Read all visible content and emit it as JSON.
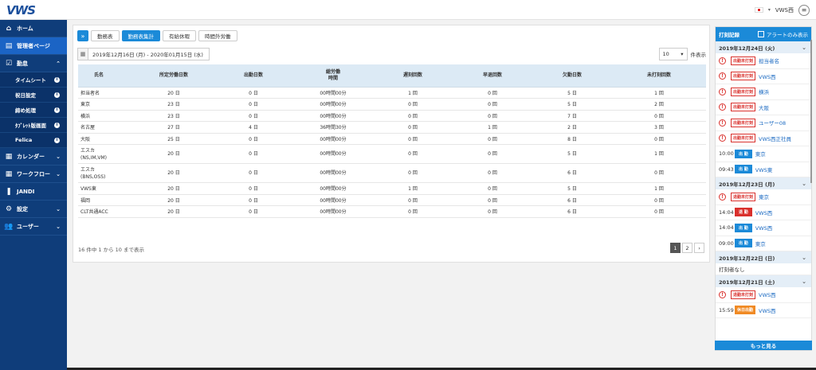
{
  "app": {
    "logo": "VWS",
    "user": "VWS西"
  },
  "sidebar": {
    "items": [
      {
        "label": "ホーム",
        "icon": "home-icon",
        "glyph": "⌂"
      },
      {
        "label": "管理者ページ",
        "icon": "admin-icon",
        "glyph": "▤"
      },
      {
        "label": "勤怠",
        "icon": "attendance-icon",
        "glyph": "☑"
      }
    ],
    "subs": [
      "タイムシート",
      "祝日設定",
      "締め処理",
      "ﾀﾌﾞﾚｯﾄ版画面",
      "Felica"
    ],
    "lower": [
      {
        "label": "カレンダー",
        "glyph": "▦"
      },
      {
        "label": "ワークフロー",
        "glyph": "▦"
      },
      {
        "label": "JANDI",
        "glyph": "❚"
      },
      {
        "label": "設定",
        "glyph": "⚙"
      },
      {
        "label": "ユーザー",
        "glyph": "👥"
      }
    ]
  },
  "tabs": [
    "勤務表",
    "勤務表集計",
    "有給休暇",
    "時間外労働"
  ],
  "date_range": "2019年12月16日 (月) - 2020年01月15日 (水)",
  "per_page": {
    "value": "10",
    "label": "件表示"
  },
  "table": {
    "headers": [
      "氏名",
      "所定労働日数",
      "出勤日数",
      "総労働\n時間",
      "遅刻回数",
      "早退回数",
      "欠勤日数",
      "未打刻回数"
    ],
    "rows": [
      [
        "担当者名",
        "20 日",
        "0 日",
        "00時間00分",
        "1 回",
        "0 回",
        "5 日",
        "1 回"
      ],
      [
        "東京",
        "23 日",
        "0 日",
        "00時間00分",
        "0 回",
        "0 回",
        "5 日",
        "2 回"
      ],
      [
        "横浜",
        "23 日",
        "0 日",
        "00時間00分",
        "0 回",
        "0 回",
        "7 日",
        "0 回"
      ],
      [
        "名古屋",
        "27 日",
        "4 日",
        "36時間30分",
        "0 回",
        "1 回",
        "2 日",
        "3 回"
      ],
      [
        "大阪",
        "25 日",
        "0 日",
        "00時間00分",
        "0 回",
        "0 回",
        "8 日",
        "0 回"
      ],
      [
        "エスカ\n(NS,IM,VM)",
        "20 日",
        "0 日",
        "00時間00分",
        "0 回",
        "0 回",
        "5 日",
        "1 回"
      ],
      [
        "エスカ\n(BNS,OSS)",
        "20 日",
        "0 日",
        "00時間00分",
        "0 回",
        "0 回",
        "6 日",
        "0 回"
      ],
      [
        "VWS東",
        "20 日",
        "0 日",
        "00時間00分",
        "1 回",
        "0 回",
        "5 日",
        "1 回"
      ],
      [
        "福岡",
        "20 日",
        "0 日",
        "00時間00分",
        "0 回",
        "0 回",
        "6 日",
        "0 回"
      ],
      [
        "CLT共通ACC",
        "20 日",
        "0 日",
        "00時間00分",
        "0 回",
        "0 回",
        "6 日",
        "0 回"
      ]
    ]
  },
  "footer": {
    "info": "16 件中 1 から 10 まで表示",
    "pages": [
      "1",
      "2",
      "›"
    ]
  },
  "log": {
    "title": "打刻記録",
    "alert_only": "アラートのみ表示",
    "more": "もっと見る",
    "days": [
      {
        "date": "2019年12月24日 (火)",
        "entries": [
          {
            "type": "warn",
            "badge": "出勤未打刻",
            "name": "担当者名"
          },
          {
            "type": "warn",
            "badge": "出勤未打刻",
            "name": "VWS西"
          },
          {
            "type": "warn",
            "badge": "出勤未打刻",
            "name": "横浜"
          },
          {
            "type": "warn",
            "badge": "出勤未打刻",
            "name": "大阪"
          },
          {
            "type": "warn",
            "badge": "出勤未打刻",
            "name": "ユーザー08"
          },
          {
            "type": "warn",
            "badge": "出勤未打刻",
            "name": "VWS西正社員"
          },
          {
            "type": "in",
            "time": "10:00",
            "badge": "出 勤",
            "name": "東京"
          },
          {
            "type": "in",
            "time": "09:43",
            "badge": "出 勤",
            "name": "VWS東"
          }
        ]
      },
      {
        "date": "2019年12月23日 (月)",
        "entries": [
          {
            "type": "warn",
            "badge": "退勤未打刻",
            "name": "東京"
          },
          {
            "type": "out",
            "time": "14:04",
            "badge": "退 勤",
            "name": "VWS西"
          },
          {
            "type": "in",
            "time": "14:04",
            "badge": "出 勤",
            "name": "VWS西"
          },
          {
            "type": "in",
            "time": "09:00",
            "badge": "出 勤",
            "name": "東京"
          }
        ]
      },
      {
        "date": "2019年12月22日 (日)",
        "none": "打刻者なし",
        "entries": []
      },
      {
        "date": "2019年12月21日 (土)",
        "entries": [
          {
            "type": "warn",
            "badge": "退勤未打刻",
            "name": "VWS西"
          },
          {
            "type": "holiday",
            "time": "15:59",
            "badge": "休日出勤",
            "name": "VWS西"
          }
        ]
      }
    ]
  }
}
